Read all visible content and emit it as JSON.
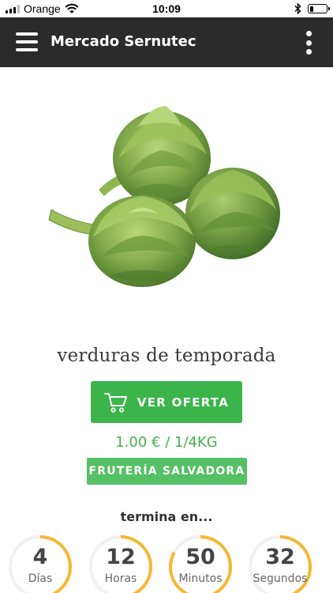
{
  "status_bar": {
    "carrier": "Orange",
    "time": "10:09",
    "signal_bars_filled": 3,
    "signal_bars_total": 4,
    "battery_level": 0.25
  },
  "app_bar": {
    "title": "Mercado Sernutec",
    "background_color": "#2b2b2b",
    "icons": [
      "menu-icon",
      "more-vertical-icon"
    ]
  },
  "product": {
    "image": "artichokes-photo",
    "title": "verduras de temporada",
    "offer_button_label": "VER OFERTA",
    "offer_button_icon": "cart-icon",
    "price": "1.00 € / 1/4KG",
    "shop_label": "FRUTERÍA SALVADORA",
    "accent_color": "#3bb54a"
  },
  "countdown": {
    "label": "termina en...",
    "ring_color": "#f7b733",
    "units": [
      {
        "value": "4",
        "unit": "Días",
        "progress": 0.57
      },
      {
        "value": "12",
        "unit": "Horas",
        "progress": 0.5
      },
      {
        "value": "50",
        "unit": "Minutos",
        "progress": 0.83
      },
      {
        "value": "32",
        "unit": "Segundos",
        "progress": 0.53
      }
    ]
  }
}
